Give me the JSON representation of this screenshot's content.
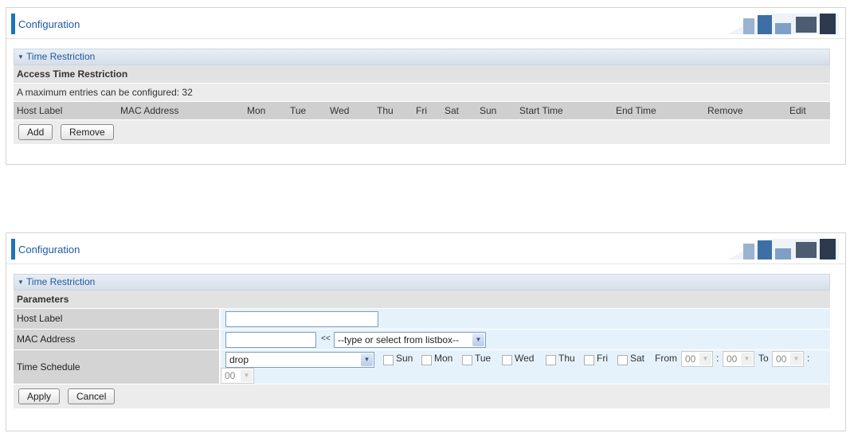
{
  "panel1": {
    "header_title": "Configuration",
    "section_title": "Time Restriction",
    "subsection_title": "Access Time Restriction",
    "max_entries_text": "A maximum entries can be configured: 32",
    "columns": [
      "Host Label",
      "MAC Address",
      "Mon",
      "Tue",
      "Wed",
      "Thu",
      "Fri",
      "Sat",
      "Sun",
      "Start Time",
      "End Time",
      "Remove",
      "Edit"
    ],
    "add_label": "Add",
    "remove_label": "Remove"
  },
  "panel2": {
    "header_title": "Configuration",
    "section_title": "Time Restriction",
    "subsection_title": "Parameters",
    "host_label": "Host Label",
    "host_value": "",
    "mac_label": "MAC Address",
    "mac_value": "",
    "mac_arrow": "<<",
    "mac_select": "--type or select from listbox--",
    "time_label": "Time Schedule",
    "action_select": "drop",
    "days": [
      "Sun",
      "Mon",
      "Tue",
      "Wed",
      "Thu",
      "Fri",
      "Sat"
    ],
    "from_label": "From",
    "from_hour": "00",
    "colon": ":",
    "from_min": "00",
    "to_label": "To",
    "to_hour": "00",
    "to_min": "00",
    "apply_label": "Apply",
    "cancel_label": "Cancel"
  }
}
